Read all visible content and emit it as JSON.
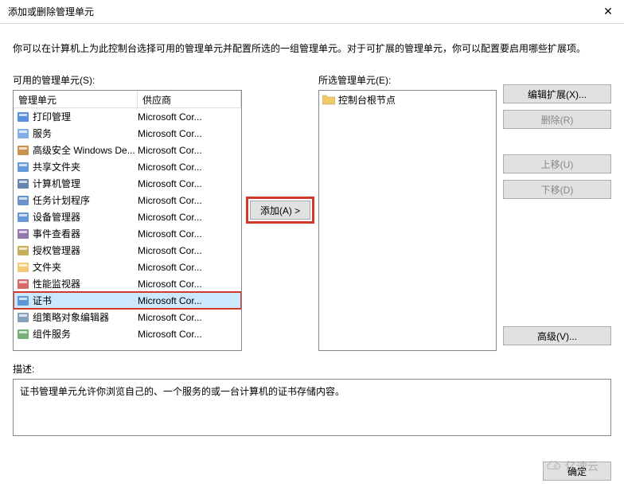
{
  "title": "添加或删除管理单元",
  "close_glyph": "✕",
  "intro": "你可以在计算机上为此控制台选择可用的管理单元并配置所选的一组管理单元。对于可扩展的管理单元，你可以配置要启用哪些扩展项。",
  "available_label": "可用的管理单元(S):",
  "selected_label": "所选管理单元(E):",
  "headers": {
    "name": "管理单元",
    "vendor": "供应商"
  },
  "add_btn": "添加(A) >",
  "buttons": {
    "edit_ext": "编辑扩展(X)...",
    "remove": "删除(R)",
    "move_up": "上移(U)",
    "move_down": "下移(D)",
    "advanced": "高级(V)..."
  },
  "tree_root": "控制台根节点",
  "desc_label": "描述:",
  "desc_text": "证书管理单元允许你浏览自己的、一个服务的或一台计算机的证书存储内容。",
  "ok": "确定",
  "watermark": "亿速云",
  "snapins": [
    {
      "name": "打印管理",
      "vendor": "Microsoft Cor...",
      "icon": "printer",
      "color": "#3b7dd8"
    },
    {
      "name": "服务",
      "vendor": "Microsoft Cor...",
      "icon": "gear",
      "color": "#6aa0e0"
    },
    {
      "name": "高级安全 Windows De...",
      "vendor": "Microsoft Cor...",
      "icon": "firewall",
      "color": "#c08030"
    },
    {
      "name": "共享文件夹",
      "vendor": "Microsoft Cor...",
      "icon": "share",
      "color": "#4a88d0"
    },
    {
      "name": "计算机管理",
      "vendor": "Microsoft Cor...",
      "icon": "computer",
      "color": "#4a6ea0"
    },
    {
      "name": "任务计划程序",
      "vendor": "Microsoft Cor...",
      "icon": "clock",
      "color": "#5080c0"
    },
    {
      "name": "设备管理器",
      "vendor": "Microsoft Cor...",
      "icon": "device",
      "color": "#4a88d0"
    },
    {
      "name": "事件查看器",
      "vendor": "Microsoft Cor...",
      "icon": "event",
      "color": "#8060a0"
    },
    {
      "name": "授权管理器",
      "vendor": "Microsoft Cor...",
      "icon": "auth",
      "color": "#c0a040"
    },
    {
      "name": "文件夹",
      "vendor": "Microsoft Cor...",
      "icon": "folder",
      "color": "#f0c060"
    },
    {
      "name": "性能监视器",
      "vendor": "Microsoft Cor...",
      "icon": "perf",
      "color": "#d05050"
    },
    {
      "name": "证书",
      "vendor": "Microsoft Cor...",
      "icon": "cert",
      "color": "#4a88d0",
      "selected": true
    },
    {
      "name": "组策略对象编辑器",
      "vendor": "Microsoft Cor...",
      "icon": "gpo",
      "color": "#7090b0"
    },
    {
      "name": "组件服务",
      "vendor": "Microsoft Cor...",
      "icon": "comp",
      "color": "#60a060"
    }
  ]
}
